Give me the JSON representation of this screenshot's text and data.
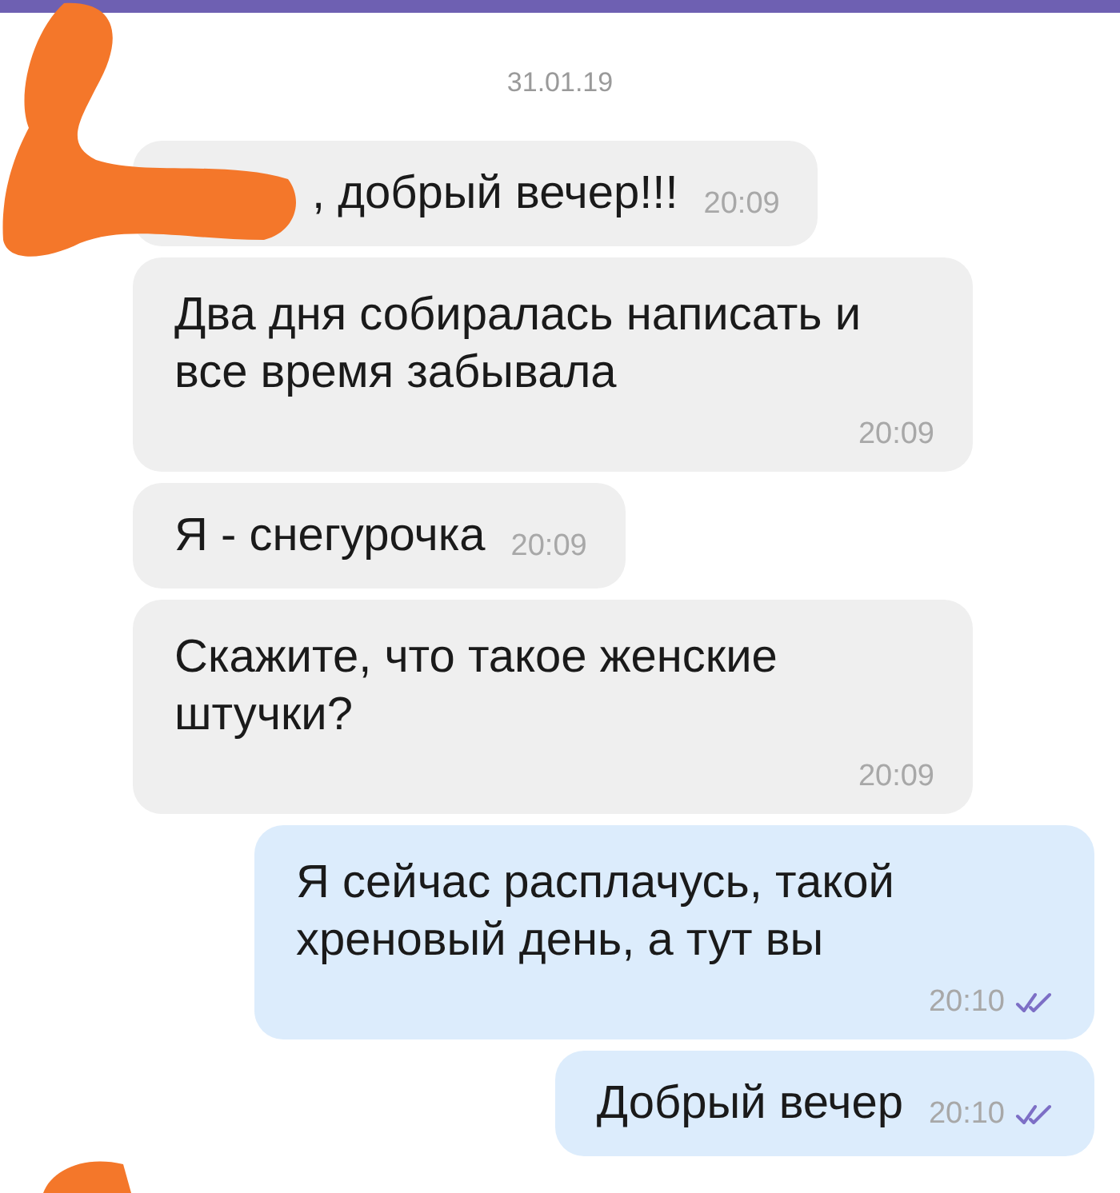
{
  "date": "31.01.19",
  "messages": [
    {
      "kind": "incoming",
      "text": ", добрый вечер!!!",
      "time": "20:09",
      "time_below": false,
      "redacted": true
    },
    {
      "kind": "incoming",
      "text": "Два дня собиралась написать и все время забывала",
      "time": "20:09",
      "time_below": true,
      "redacted": false
    },
    {
      "kind": "incoming",
      "text": "Я - снегурочка",
      "time": "20:09",
      "time_below": false,
      "redacted": false
    },
    {
      "kind": "incoming",
      "text": "Скажите, что такое женские штучки?",
      "time": "20:09",
      "time_below": true,
      "redacted": false
    },
    {
      "kind": "outgoing",
      "text": "Я сейчас расплачусь, такой хреновый день, а тут вы",
      "time": "20:10",
      "time_below": true,
      "read": true
    },
    {
      "kind": "outgoing",
      "text": "Добрый вечер",
      "time": "20:10",
      "time_below": false,
      "read": true
    }
  ]
}
